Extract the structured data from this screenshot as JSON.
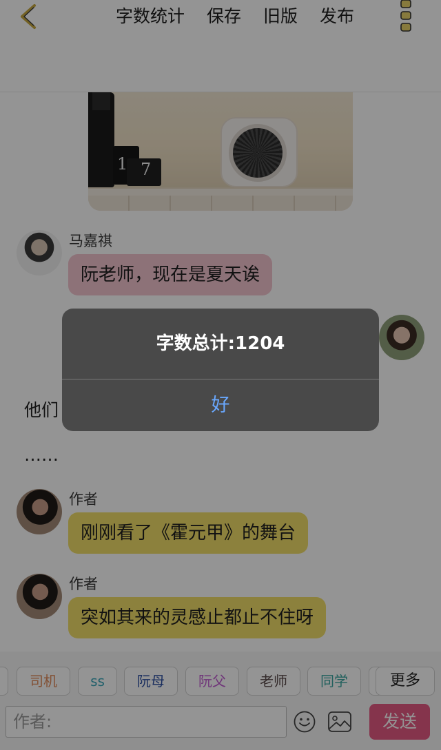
{
  "header": {
    "nav": [
      "字数统计",
      "保存",
      "旧版",
      "发布"
    ],
    "back_icon": "chevron-left-icon",
    "menu_icon": "three-dots-vertical-icon"
  },
  "chat": {
    "photo_digits": {
      "cube_a": "1",
      "cube_b": "7"
    },
    "messages": [
      {
        "sender": "马嘉祺",
        "text": "阮老师，现在是夏天诶",
        "color": "#f3c4cf"
      },
      {
        "sender": "作者",
        "text": "刚刚看了《霍元甲》的舞台",
        "color": "#f2de6a"
      },
      {
        "sender": "作者",
        "text": "突如其来的灵感止都止不住呀",
        "color": "#f2de6a"
      }
    ],
    "narration": [
      "他们",
      "……"
    ]
  },
  "toolbar": {
    "chips": [
      {
        "label": "",
        "color": "#444444"
      },
      {
        "label": "司机",
        "color": "#e08a5a"
      },
      {
        "label": "ss",
        "color": "#3aa6b9"
      },
      {
        "label": "阮母",
        "color": "#2b4fa3"
      },
      {
        "label": "阮父",
        "color": "#c05bd0"
      },
      {
        "label": "老师",
        "color": "#5a4a4a"
      },
      {
        "label": "同学",
        "color": "#3aa6a0"
      },
      {
        "label": "",
        "color": "#444444"
      },
      {
        "label": "更多",
        "color": "#222222"
      }
    ],
    "input_placeholder": "作者:",
    "send_label": "发送",
    "send_color": "#e65a84"
  },
  "alert": {
    "message": "字数总计:1204",
    "ok_label": "好",
    "ok_color": "#69a8ff"
  }
}
